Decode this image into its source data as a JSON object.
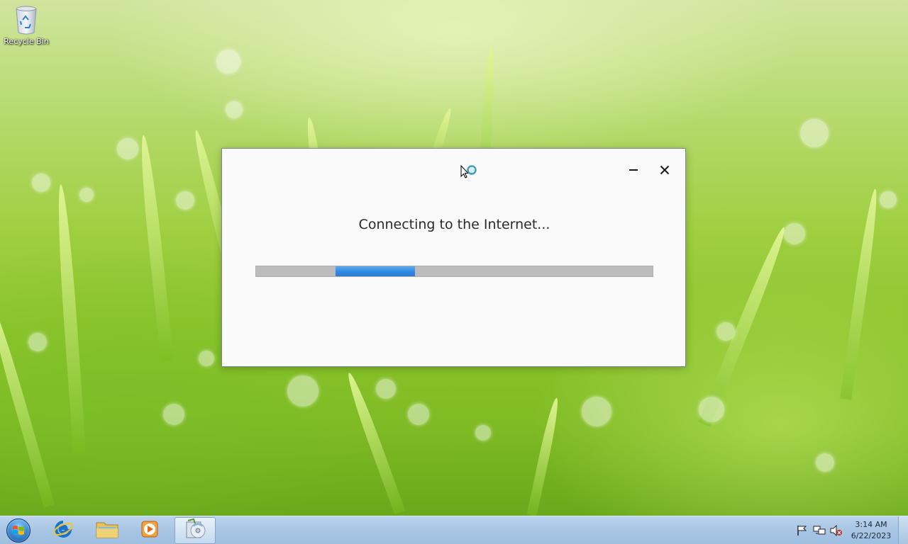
{
  "desktop": {
    "icons": [
      {
        "label": "Recycle Bin",
        "icon": "recycle-bin-icon"
      }
    ]
  },
  "dialog": {
    "message": "Connecting to the Internet...",
    "progress": {
      "state": "indeterminate",
      "segment_start": 0.2,
      "segment_length": 0.2,
      "fill_color": "#2d86e0",
      "track_color": "#bcbcbc"
    },
    "buttons": {
      "minimize_icon": "minimize-icon",
      "close_icon": "close-icon"
    }
  },
  "taskbar": {
    "start_icon": "windows-start-orb-icon",
    "pinned": [
      {
        "name": "internet-explorer",
        "icon": "internet-explorer-icon"
      },
      {
        "name": "windows-explorer",
        "icon": "folder-icon"
      },
      {
        "name": "media-player",
        "icon": "media-player-icon"
      },
      {
        "name": "setup-app",
        "icon": "setup-cd-icon",
        "active": true
      }
    ],
    "tray": {
      "icons": [
        "action-center-flag-icon",
        "network-icon",
        "volume-muted-icon"
      ],
      "time": "3:14 AM",
      "date": "6/22/2023"
    }
  },
  "colors": {
    "taskbar": "#a9c6e4",
    "dialog_bg": "#fafafa",
    "progress_blue": "#2d86e0"
  }
}
